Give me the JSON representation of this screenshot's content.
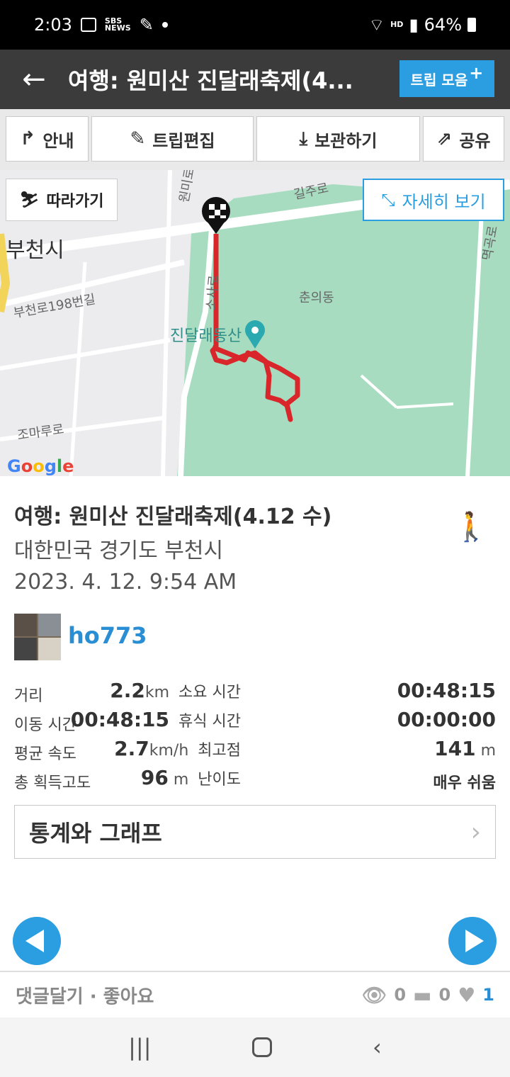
{
  "status_bar": {
    "time": "2:03",
    "battery": "64%"
  },
  "app_bar": {
    "title": "여행: 원미산 진달래축제(4...",
    "collection_label": "트립 모음",
    "collection_plus": "+"
  },
  "toolbar": {
    "guide": "안내",
    "edit": "트립편집",
    "save": "보관하기",
    "share": "공유"
  },
  "map": {
    "follow_label": "따라가기",
    "detail_label": "자세히 보기",
    "city_label": "부천시",
    "road_labels": [
      "원미로",
      "길주로",
      "부천로198번길",
      "소사로",
      "춘의동",
      "조마루로",
      "멱곡로"
    ],
    "poi_label": "진달래동산",
    "google_label": "Google"
  },
  "trip": {
    "title": "여행: 원미산 진달래축제(4.12 수)",
    "location": "대한민국 경기도 부천시",
    "datetime": "2023. 4. 12. 9:54 AM",
    "username": "ho773"
  },
  "stats": {
    "distance_label": "거리",
    "distance_value": "2.2",
    "distance_unit": "km",
    "elapsed_label": "소요 시간",
    "elapsed_value": "00:48:15",
    "moving_label": "이동 시간",
    "moving_value": "00:48:15",
    "rest_label": "휴식 시간",
    "rest_value": "00:00:00",
    "avg_speed_label": "평균 속도",
    "avg_speed_value": "2.7",
    "avg_speed_unit": "km/h",
    "max_alt_label": "최고점",
    "max_alt_value": "141",
    "max_alt_unit": "m",
    "gain_label": "총 획득고도",
    "gain_value": "96",
    "gain_unit": "m",
    "difficulty_label": "난이도",
    "difficulty_value": "매우 쉬움"
  },
  "stats_graph_label": "통계와 그래프",
  "bottom": {
    "comment_like": "댓글달기 · 좋아요",
    "views": "0",
    "comments": "0",
    "likes": "1"
  },
  "icons": {
    "back": "arrow-left-icon",
    "walk": "walking-person-icon",
    "accent": "#2a9ee0"
  }
}
